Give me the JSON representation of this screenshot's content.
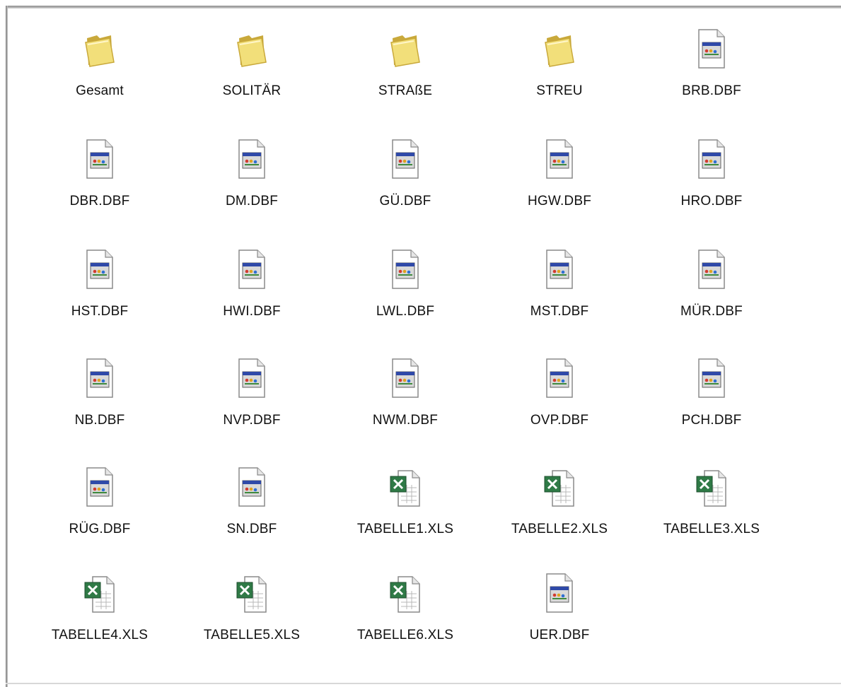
{
  "colors": {
    "folder": "#f2df7a",
    "folder_dark": "#c9a93b",
    "doc_border": "#8a8a8a",
    "dbf_titlebar": "#2f49a8",
    "xls_green": "#2f7a46"
  },
  "items": [
    {
      "label": "Gesamt",
      "type": "folder",
      "icon": "folder-icon"
    },
    {
      "label": "SOLITÄR",
      "type": "folder",
      "icon": "folder-icon"
    },
    {
      "label": "STRAßE",
      "type": "folder",
      "icon": "folder-icon"
    },
    {
      "label": "STREU",
      "type": "folder",
      "icon": "folder-icon"
    },
    {
      "label": "BRB.DBF",
      "type": "dbf",
      "icon": "dbf-file-icon"
    },
    {
      "label": "DBR.DBF",
      "type": "dbf",
      "icon": "dbf-file-icon"
    },
    {
      "label": "DM.DBF",
      "type": "dbf",
      "icon": "dbf-file-icon"
    },
    {
      "label": "GÜ.DBF",
      "type": "dbf",
      "icon": "dbf-file-icon"
    },
    {
      "label": "HGW.DBF",
      "type": "dbf",
      "icon": "dbf-file-icon"
    },
    {
      "label": "HRO.DBF",
      "type": "dbf",
      "icon": "dbf-file-icon"
    },
    {
      "label": "HST.DBF",
      "type": "dbf",
      "icon": "dbf-file-icon"
    },
    {
      "label": "HWI.DBF",
      "type": "dbf",
      "icon": "dbf-file-icon"
    },
    {
      "label": "LWL.DBF",
      "type": "dbf",
      "icon": "dbf-file-icon"
    },
    {
      "label": "MST.DBF",
      "type": "dbf",
      "icon": "dbf-file-icon"
    },
    {
      "label": "MÜR.DBF",
      "type": "dbf",
      "icon": "dbf-file-icon"
    },
    {
      "label": "NB.DBF",
      "type": "dbf",
      "icon": "dbf-file-icon"
    },
    {
      "label": "NVP.DBF",
      "type": "dbf",
      "icon": "dbf-file-icon"
    },
    {
      "label": "NWM.DBF",
      "type": "dbf",
      "icon": "dbf-file-icon"
    },
    {
      "label": "OVP.DBF",
      "type": "dbf",
      "icon": "dbf-file-icon"
    },
    {
      "label": "PCH.DBF",
      "type": "dbf",
      "icon": "dbf-file-icon"
    },
    {
      "label": "RÜG.DBF",
      "type": "dbf",
      "icon": "dbf-file-icon"
    },
    {
      "label": "SN.DBF",
      "type": "dbf",
      "icon": "dbf-file-icon"
    },
    {
      "label": "TABELLE1.XLS",
      "type": "xls",
      "icon": "excel-file-icon"
    },
    {
      "label": "TABELLE2.XLS",
      "type": "xls",
      "icon": "excel-file-icon"
    },
    {
      "label": "TABELLE3.XLS",
      "type": "xls",
      "icon": "excel-file-icon"
    },
    {
      "label": "TABELLE4.XLS",
      "type": "xls",
      "icon": "excel-file-icon"
    },
    {
      "label": "TABELLE5.XLS",
      "type": "xls",
      "icon": "excel-file-icon"
    },
    {
      "label": "TABELLE6.XLS",
      "type": "xls",
      "icon": "excel-file-icon"
    },
    {
      "label": "UER.DBF",
      "type": "dbf",
      "icon": "dbf-file-icon"
    }
  ]
}
